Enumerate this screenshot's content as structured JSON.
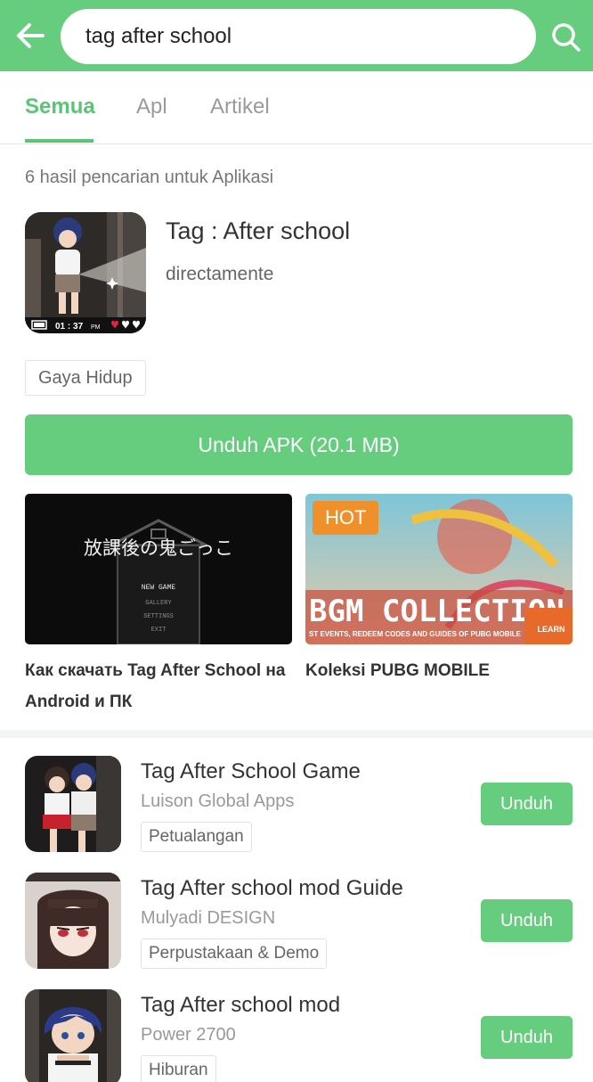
{
  "search": {
    "query": "tag after school"
  },
  "tabs": [
    {
      "label": "Semua",
      "active": true
    },
    {
      "label": "Apl",
      "active": false
    },
    {
      "label": "Artikel",
      "active": false
    }
  ],
  "result_count": "6 hasil pencarian untuk Aplikasi",
  "featured_app": {
    "title": "Tag : After school",
    "subtitle": "directamente",
    "category": "Gaya Hidup",
    "download_label": "Unduh APK (20.1 MB)",
    "icon_time": "01 : 37",
    "icon_ampm": "PM"
  },
  "articles": [
    {
      "title": "Как скачать Tag After School на Android и ПК",
      "thumb_text": "放課後の鬼ごっこ",
      "menu_new": "NEW GAME",
      "menu_gallery": "GALLERY",
      "menu_settings": "SETTINGS",
      "menu_exit": "EXIT"
    },
    {
      "title": "Koleksi PUBG MOBILE",
      "badge": "HOT",
      "thumb_text": "BGM COLLECTION",
      "thumb_sub": "ST EVENTS, REDEEM CODES AND GUIDES OF PUBG MOBILE",
      "corner_label": "LEARN"
    }
  ],
  "apps": [
    {
      "name": "Tag After School Game",
      "developer": "Luison Global Apps",
      "category": "Petualangan",
      "button": "Unduh"
    },
    {
      "name": "Tag After school mod Guide",
      "developer": "Mulyadi DESIGN",
      "category": "Perpustakaan & Demo",
      "button": "Unduh"
    },
    {
      "name": "Tag After school mod",
      "developer": "Power 2700",
      "category": "Hiburan",
      "button": "Unduh"
    }
  ],
  "colors": {
    "brand_green": "#66cc7e",
    "tab_active": "#5cc474",
    "hot_badge": "#f0902a"
  }
}
